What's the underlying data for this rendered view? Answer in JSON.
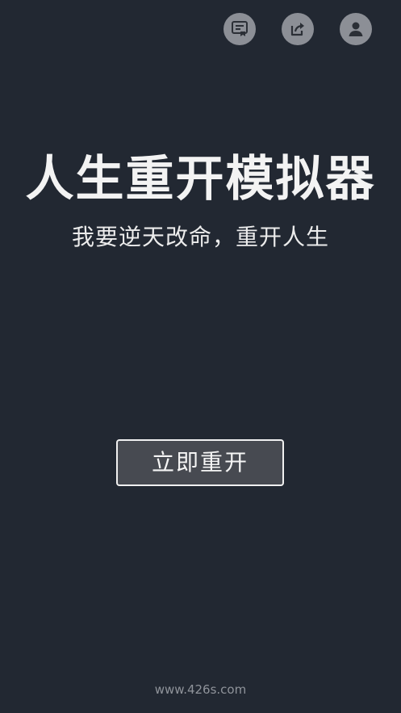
{
  "toolbar": {
    "icons": [
      {
        "name": "feedback-icon"
      },
      {
        "name": "share-icon"
      },
      {
        "name": "profile-icon"
      }
    ]
  },
  "main": {
    "title": "人生重开模拟器",
    "subtitle": "我要逆天改命，重开人生",
    "restart_label": "立即重开"
  },
  "footer": {
    "watermark": "www.426s.com"
  },
  "colors": {
    "background": "#222832",
    "icon_background": "#8c8f96",
    "button_background": "#474a51",
    "button_border": "#f0f0f0",
    "text_primary": "#f3f3f3",
    "text_muted": "#8f939a"
  }
}
